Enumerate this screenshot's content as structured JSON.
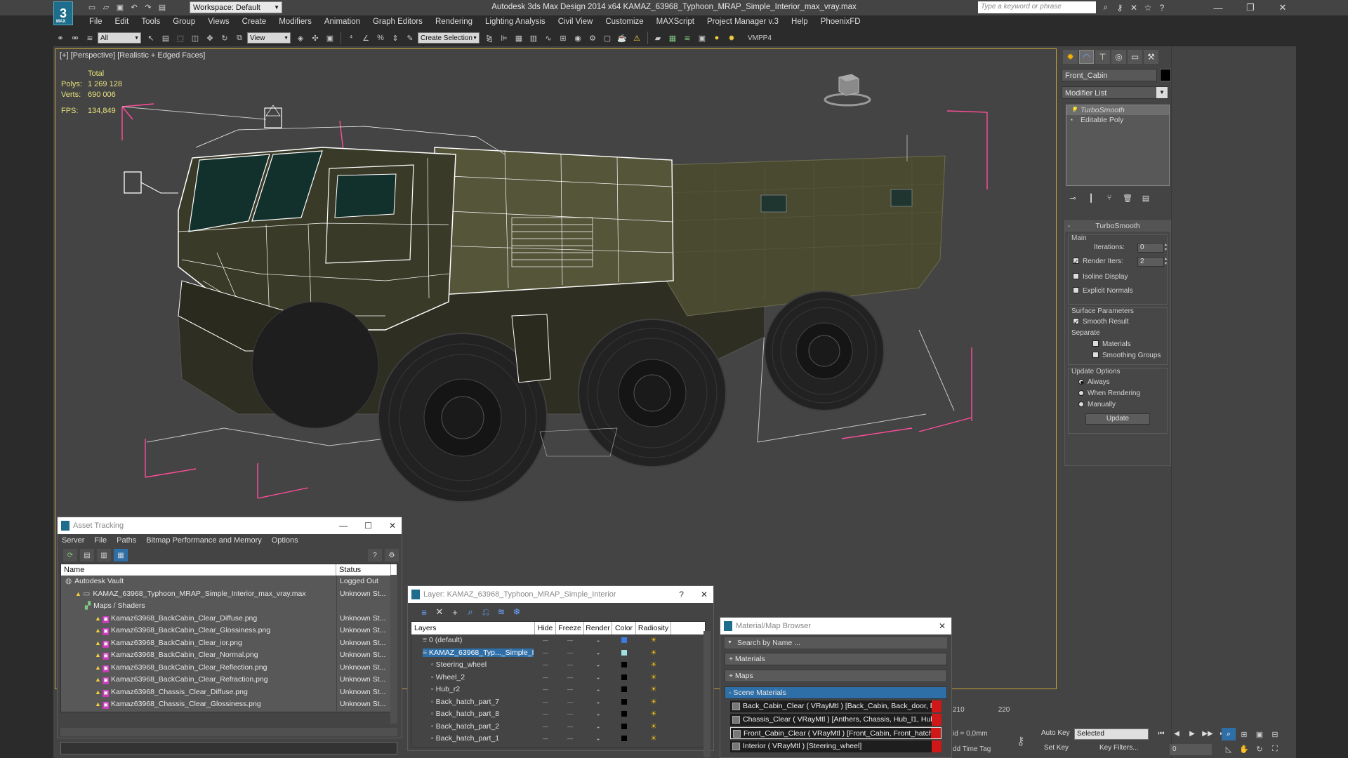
{
  "window": {
    "title": "Autodesk 3ds Max Design 2014 x64      KAMAZ_63968_Typhoon_MRAP_Simple_Interior_max_vray.max",
    "workspace": "Workspace: Default",
    "search_placeholder": "Type a keyword or phrase",
    "logo_sub": "MAX"
  },
  "menu": [
    "File",
    "Edit",
    "Tools",
    "Group",
    "Views",
    "Create",
    "Modifiers",
    "Animation",
    "Graph Editors",
    "Rendering",
    "Lighting Analysis",
    "Civil View",
    "Customize",
    "MAXScript",
    "Project Manager v.3",
    "Help",
    "PhoenixFD"
  ],
  "toolbar": {
    "filter": "All",
    "coord_system": "View",
    "selection_set": "Create Selection Se",
    "vmpp": "VMPP4"
  },
  "viewport": {
    "label": "[+] [Perspective] [Realistic + Edged Faces]",
    "stats_header": "Total",
    "polys_label": "Polys:",
    "polys_value": "1 269 128",
    "verts_label": "Verts:",
    "verts_value": "690 006",
    "fps_label": "FPS:",
    "fps_value": "134,849"
  },
  "command_panel": {
    "object_name": "Front_Cabin",
    "modifier_list": "Modifier List",
    "stack": [
      {
        "label": "TurboSmooth",
        "selected": true
      },
      {
        "label": "Editable Poly",
        "selected": false
      }
    ],
    "turbosmooth": {
      "title": "TurboSmooth",
      "main_group": "Main",
      "iterations_label": "Iterations:",
      "iterations_value": "0",
      "render_iters_label": "Render Iters:",
      "render_iters_value": "2",
      "render_iters_checked": true,
      "isoline_label": "Isoline Display",
      "explicit_label": "Explicit Normals",
      "surface_group": "Surface Parameters",
      "smooth_result_label": "Smooth Result",
      "separate_label": "Separate",
      "materials_label": "Materials",
      "smoothing_groups_label": "Smoothing Groups",
      "update_group": "Update Options",
      "always_label": "Always",
      "when_rendering_label": "When Rendering",
      "manually_label": "Manually",
      "update_button": "Update"
    }
  },
  "asset_tracking": {
    "title": "Asset Tracking",
    "menu": [
      "Server",
      "File",
      "Paths",
      "Bitmap Performance and Memory",
      "Options"
    ],
    "columns": [
      "Name",
      "Status"
    ],
    "rows": [
      {
        "name": "Autodesk Vault",
        "status": "Logged Out",
        "indent": 0,
        "kind": "vault"
      },
      {
        "name": "KAMAZ_63968_Typhoon_MRAP_Simple_Interior_max_vray.max",
        "status": "Unknown St...",
        "indent": 1,
        "kind": "file"
      },
      {
        "name": "Maps / Shaders",
        "status": "",
        "indent": 2,
        "kind": "folder"
      },
      {
        "name": "Kamaz63968_BackCabin_Clear_Diffuse.png",
        "status": "Unknown St...",
        "indent": 3,
        "kind": "png"
      },
      {
        "name": "Kamaz63968_BackCabin_Clear_Glossiness.png",
        "status": "Unknown St...",
        "indent": 3,
        "kind": "png"
      },
      {
        "name": "Kamaz63968_BackCabin_Clear_ior.png",
        "status": "Unknown St...",
        "indent": 3,
        "kind": "png"
      },
      {
        "name": "Kamaz63968_BackCabin_Clear_Normal.png",
        "status": "Unknown St...",
        "indent": 3,
        "kind": "png"
      },
      {
        "name": "Kamaz63968_BackCabin_Clear_Reflection.png",
        "status": "Unknown St...",
        "indent": 3,
        "kind": "png"
      },
      {
        "name": "Kamaz63968_BackCabin_Clear_Refraction.png",
        "status": "Unknown St...",
        "indent": 3,
        "kind": "png"
      },
      {
        "name": "Kamaz63968_Chassis_Clear_Diffuse.png",
        "status": "Unknown St...",
        "indent": 3,
        "kind": "png"
      },
      {
        "name": "Kamaz63968_Chassis_Clear_Glossiness.png",
        "status": "Unknown St...",
        "indent": 3,
        "kind": "png"
      }
    ]
  },
  "layer_window": {
    "title": "Layer: KAMAZ_63968_Typhoon_MRAP_Simple_Interior",
    "columns": [
      "Layers",
      "Hide",
      "Freeze",
      "Render",
      "Color",
      "Radiosity"
    ],
    "rows": [
      {
        "name": "0 (default)",
        "color": "#3d7ae0",
        "selected": false
      },
      {
        "name": "KAMAZ_63968_Typ..._Simple_I",
        "color": "#9fe0e0",
        "selected": true
      },
      {
        "name": "Steering_wheel",
        "color": "#000000",
        "selected": false
      },
      {
        "name": "Wheel_2",
        "color": "#000000",
        "selected": false
      },
      {
        "name": "Hub_r2",
        "color": "#000000",
        "selected": false
      },
      {
        "name": "Back_hatch_part_7",
        "color": "#000000",
        "selected": false
      },
      {
        "name": "Back_hatch_part_8",
        "color": "#000000",
        "selected": false
      },
      {
        "name": "Back_hatch_part_2",
        "color": "#000000",
        "selected": false
      },
      {
        "name": "Back_hatch_part_1",
        "color": "#000000",
        "selected": false
      }
    ]
  },
  "material_browser": {
    "title": "Material/Map Browser",
    "search_placeholder": "Search by Name ...",
    "sections": [
      "+ Materials",
      "+ Maps",
      "- Scene Materials"
    ],
    "items": [
      "Back_Cabin_Clear  ( VRayMtl ) [Back_Cabin, Back_door, B...",
      "Chassis_Clear  ( VRayMtl ) [Anthers, Chassis, Hub_l1, Hub...",
      "Front_Cabin_Clear  ( VRayMtl ) [Front_Cabin, Front_hatch...",
      "Interior  ( VRayMtl ) [Steering_wheel]"
    ]
  },
  "status": {
    "timeline_210": "210",
    "timeline_220": "220",
    "coord_text": "id = 0,0mm",
    "add_time_tag": "dd Time Tag",
    "auto_key": "Auto Key",
    "set_key": "Set Key",
    "selected": "Selected",
    "key_filters": "Key Filters...",
    "frame": "0"
  },
  "colors": {
    "accent": "#2f6fa8",
    "viewport_border": "#c9a33a",
    "bbox_pink": "#ff4d9a",
    "stats_yellow": "#e6e07a",
    "vehicle_olive": "#3a3a26"
  }
}
